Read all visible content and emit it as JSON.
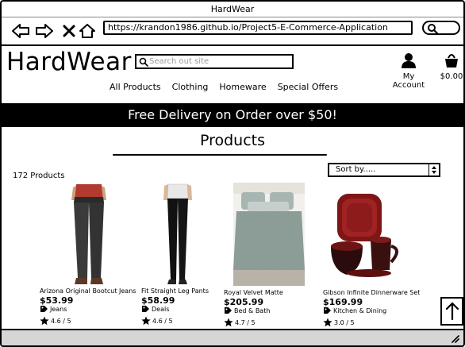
{
  "browser": {
    "title": "HardWear",
    "url": "https://krandon1986.github.io/Project5-E-Commerce-Application"
  },
  "site": {
    "logo": "HardWear",
    "search_placeholder": "Search out site",
    "account_label": "My Account",
    "cart_total": "$0.00",
    "menu": [
      "All Products",
      "Clothing",
      "Homeware",
      "Special Offers"
    ],
    "promo": "Free Delivery on Order over $50!",
    "section_title": "Products",
    "product_count": "172 Products",
    "sort_label": "Sort by....."
  },
  "products": [
    {
      "name": "Arizona Original Bootcut Jeans",
      "price": "$53.99",
      "category": "Jeans",
      "rating": "4.6 / 5"
    },
    {
      "name": "Fit Straight Leg Pants",
      "price": "$58.99",
      "category": "Deals",
      "rating": "4.6 / 5"
    },
    {
      "name": "Royal Velvet Matte",
      "price": "$205.99",
      "category": "Bed & Bath",
      "rating": "4.7 / 5"
    },
    {
      "name": "Gibson Infinite Dinnerware Set",
      "price": "$169.99",
      "category": "Kitchen & Dining",
      "rating": "3.0 / 5"
    }
  ],
  "colors": {
    "promo_bg": "#000000",
    "promo_text": "#ffffff",
    "dinnerware_red": "#8b1a1a",
    "status_bar": "#d6d6d6"
  }
}
